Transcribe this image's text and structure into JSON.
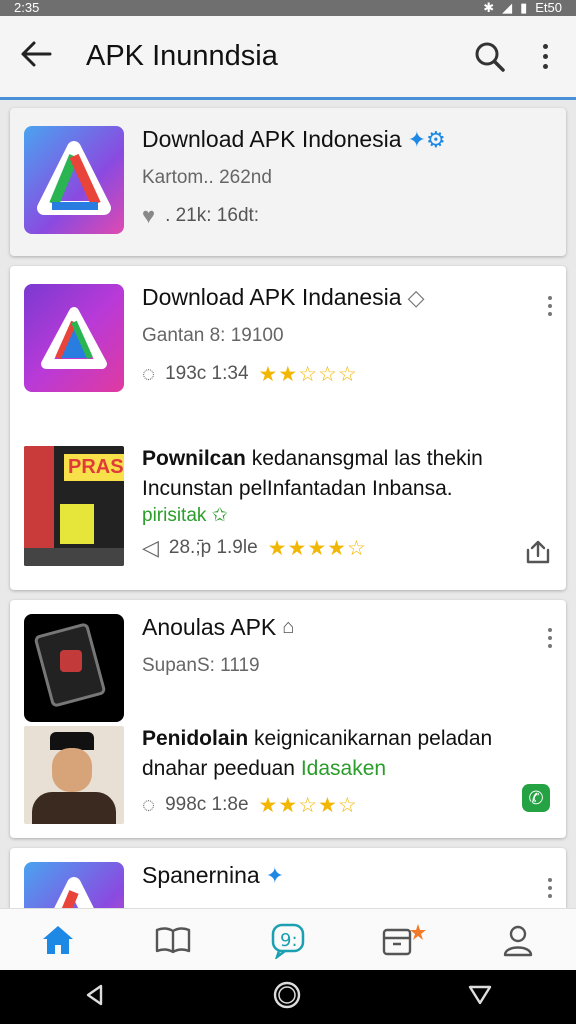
{
  "status": {
    "time": "2:35",
    "battery": "Et50"
  },
  "appbar": {
    "title": "APK Inunndsia"
  },
  "cards": [
    {
      "title": "Download APK Indonesia",
      "sub": "Kartom.. 262nd",
      "stat": ". 21k: 16dt:"
    },
    {
      "title": "Download APK Indanesia",
      "sub": "Gantan 8: 19100",
      "stat": "193c 1:34",
      "post": {
        "title_bold": "Pownilcan",
        "title_rest": " kedanansgmal las thekin",
        "line2": "Incunstan pelInfantadan Inbansa.",
        "tag": "pirisitak",
        "stat": "28.;̄p 1.9le",
        "image_text": "PRASI"
      }
    },
    {
      "title": "Anoulas APK",
      "sub": "SupanS: 1119",
      "post": {
        "title_bold": "Penidolain",
        "title_rest": " keignicanikarnan peladan",
        "line2": "dnahar peeduan",
        "tag": "Idasaken",
        "stat": "998c 1:8e"
      }
    },
    {
      "title": "Spanernina"
    }
  ],
  "colors": {
    "accent": "#1e88e5",
    "star": "#f2b705",
    "green": "#2a9d2a"
  }
}
